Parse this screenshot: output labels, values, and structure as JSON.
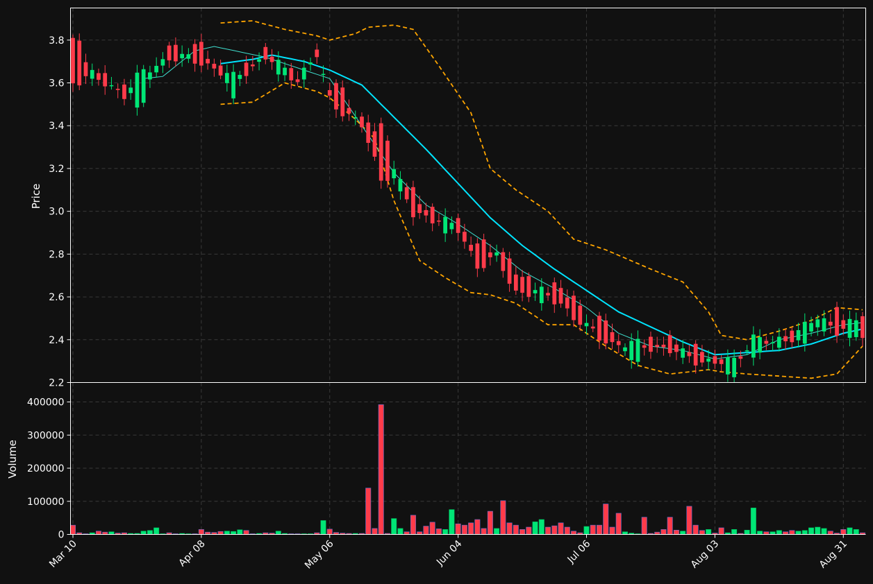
{
  "chart_data": [
    {
      "type": "candlestick",
      "panel": "price",
      "ylabel": "Price",
      "ylim": [
        2.2,
        3.95
      ],
      "yticks": [
        "2.2",
        "2.4",
        "2.6",
        "2.8",
        "3.0",
        "3.2",
        "3.4",
        "3.6",
        "3.8"
      ],
      "grid": true,
      "date_labels": [
        "Mar 10",
        "Apr 08",
        "May 06",
        "Jun 04",
        "Jul 06",
        "Aug 03",
        "Aug 31"
      ],
      "date_label_index": [
        0,
        20,
        40,
        60,
        80,
        100,
        120
      ],
      "bar_count": 124,
      "colors": {
        "up": "#00e676",
        "down": "#ff3b4a",
        "ma_fast": "#40e0d0",
        "ma_slow": "#00e5ff",
        "bands": "#ffa500",
        "background": "#111111",
        "grid": "#3a3a3a",
        "text": "#ffffff"
      },
      "overlays": [
        "ma_fast",
        "ma_slow",
        "bollinger_upper",
        "bollinger_lower"
      ],
      "anchors": {
        "open": [
          [
            0,
            3.79
          ],
          [
            3,
            3.67
          ],
          [
            8,
            3.55
          ],
          [
            11,
            3.53
          ],
          [
            15,
            3.75
          ],
          [
            20,
            3.76
          ],
          [
            25,
            3.58
          ],
          [
            30,
            3.75
          ],
          [
            35,
            3.59
          ],
          [
            38,
            3.74
          ],
          [
            40,
            3.6
          ],
          [
            45,
            3.43
          ],
          [
            48,
            3.4
          ],
          [
            50,
            3.15
          ],
          [
            53,
            3.1
          ],
          [
            57,
            2.93
          ],
          [
            60,
            2.95
          ],
          [
            63,
            2.82
          ],
          [
            66,
            2.84
          ],
          [
            69,
            2.72
          ],
          [
            72,
            2.62
          ],
          [
            76,
            2.64
          ],
          [
            80,
            2.51
          ],
          [
            84,
            2.45
          ],
          [
            86,
            2.32
          ],
          [
            90,
            2.37
          ],
          [
            93,
            2.4
          ],
          [
            97,
            2.33
          ],
          [
            100,
            2.32
          ],
          [
            103,
            2.25
          ],
          [
            106,
            2.34
          ],
          [
            109,
            2.4
          ],
          [
            112,
            2.39
          ],
          [
            116,
            2.45
          ],
          [
            119,
            2.5
          ],
          [
            122,
            2.43
          ],
          [
            123,
            2.49
          ]
        ],
        "close": [
          [
            0,
            3.61
          ],
          [
            3,
            3.63
          ],
          [
            8,
            3.55
          ],
          [
            11,
            3.65
          ],
          [
            15,
            3.72
          ],
          [
            20,
            3.7
          ],
          [
            25,
            3.62
          ],
          [
            30,
            3.72
          ],
          [
            35,
            3.62
          ],
          [
            38,
            3.73
          ],
          [
            40,
            3.52
          ],
          [
            45,
            3.4
          ],
          [
            48,
            3.15
          ],
          [
            50,
            3.2
          ],
          [
            53,
            2.98
          ],
          [
            57,
            2.97
          ],
          [
            60,
            2.91
          ],
          [
            63,
            2.75
          ],
          [
            66,
            2.78
          ],
          [
            69,
            2.62
          ],
          [
            72,
            2.63
          ],
          [
            76,
            2.57
          ],
          [
            80,
            2.45
          ],
          [
            84,
            2.38
          ],
          [
            86,
            2.38
          ],
          [
            90,
            2.37
          ],
          [
            93,
            2.35
          ],
          [
            97,
            2.31
          ],
          [
            100,
            2.29
          ],
          [
            103,
            2.3
          ],
          [
            106,
            2.41
          ],
          [
            109,
            2.38
          ],
          [
            112,
            2.42
          ],
          [
            116,
            2.5
          ],
          [
            119,
            2.45
          ],
          [
            122,
            2.48
          ],
          [
            123,
            2.42
          ]
        ]
      },
      "wick_pad": {
        "high": 0.04,
        "low": 0.04
      },
      "bands": {
        "upper": [
          [
            23,
            3.88
          ],
          [
            28,
            3.89
          ],
          [
            33,
            3.85
          ],
          [
            38,
            3.82
          ],
          [
            40,
            3.8
          ],
          [
            44,
            3.83
          ],
          [
            46,
            3.86
          ],
          [
            50,
            3.87
          ],
          [
            53,
            3.85
          ],
          [
            57,
            3.68
          ],
          [
            62,
            3.46
          ],
          [
            65,
            3.2
          ],
          [
            69,
            3.1
          ],
          [
            74,
            3.0
          ],
          [
            78,
            2.87
          ],
          [
            83,
            2.82
          ],
          [
            90,
            2.73
          ],
          [
            95,
            2.67
          ],
          [
            99,
            2.53
          ],
          [
            101,
            2.42
          ],
          [
            105,
            2.4
          ],
          [
            110,
            2.44
          ],
          [
            115,
            2.49
          ],
          [
            119,
            2.55
          ],
          [
            123,
            2.54
          ]
        ],
        "lower": [
          [
            23,
            3.5
          ],
          [
            28,
            3.51
          ],
          [
            33,
            3.6
          ],
          [
            38,
            3.56
          ],
          [
            40,
            3.53
          ],
          [
            44,
            3.43
          ],
          [
            47,
            3.34
          ],
          [
            50,
            3.05
          ],
          [
            54,
            2.77
          ],
          [
            58,
            2.69
          ],
          [
            62,
            2.62
          ],
          [
            65,
            2.61
          ],
          [
            69,
            2.57
          ],
          [
            74,
            2.47
          ],
          [
            78,
            2.47
          ],
          [
            83,
            2.37
          ],
          [
            88,
            2.28
          ],
          [
            93,
            2.24
          ],
          [
            99,
            2.26
          ],
          [
            101,
            2.25
          ],
          [
            105,
            2.24
          ],
          [
            110,
            2.23
          ],
          [
            115,
            2.22
          ],
          [
            119,
            2.24
          ],
          [
            123,
            2.37
          ]
        ]
      },
      "ma_fast": [
        [
          11,
          3.62
        ],
        [
          14,
          3.63
        ],
        [
          19,
          3.75
        ],
        [
          22,
          3.77
        ],
        [
          30,
          3.72
        ],
        [
          35,
          3.67
        ],
        [
          40,
          3.62
        ],
        [
          45,
          3.4
        ],
        [
          50,
          3.18
        ],
        [
          55,
          3.03
        ],
        [
          60,
          2.94
        ],
        [
          65,
          2.84
        ],
        [
          70,
          2.72
        ],
        [
          75,
          2.64
        ],
        [
          80,
          2.55
        ],
        [
          85,
          2.43
        ],
        [
          90,
          2.37
        ],
        [
          95,
          2.35
        ],
        [
          100,
          2.31
        ],
        [
          105,
          2.33
        ],
        [
          110,
          2.4
        ],
        [
          115,
          2.43
        ],
        [
          120,
          2.47
        ],
        [
          123,
          2.48
        ]
      ],
      "ma_slow": [
        [
          23,
          3.69
        ],
        [
          28,
          3.71
        ],
        [
          31,
          3.73
        ],
        [
          36,
          3.7
        ],
        [
          40,
          3.66
        ],
        [
          45,
          3.59
        ],
        [
          50,
          3.44
        ],
        [
          55,
          3.29
        ],
        [
          60,
          3.13
        ],
        [
          65,
          2.97
        ],
        [
          70,
          2.84
        ],
        [
          75,
          2.73
        ],
        [
          80,
          2.63
        ],
        [
          85,
          2.53
        ],
        [
          90,
          2.46
        ],
        [
          95,
          2.39
        ],
        [
          100,
          2.33
        ],
        [
          105,
          2.34
        ],
        [
          110,
          2.35
        ],
        [
          115,
          2.38
        ],
        [
          120,
          2.43
        ],
        [
          123,
          2.45
        ]
      ]
    },
    {
      "type": "bar",
      "panel": "volume",
      "ylabel": "Volume",
      "ylim": [
        0,
        420000
      ],
      "yticks": [
        "0",
        "100000",
        "200000",
        "300000",
        "400000"
      ],
      "grid": true,
      "values": [
        28000,
        5000,
        2000,
        5000,
        10000,
        7000,
        8000,
        4000,
        5000,
        3000,
        3000,
        10000,
        12000,
        20000,
        2000,
        5000,
        2000,
        3000,
        2000,
        2000,
        15000,
        7000,
        6000,
        9000,
        10000,
        9000,
        14000,
        12000,
        2000,
        3000,
        5000,
        4000,
        10000,
        3000,
        2000,
        2000,
        2000,
        2000,
        5000,
        42000,
        16000,
        6000,
        4000,
        3000,
        3000,
        3000,
        140000,
        18000,
        392000,
        3000,
        48000,
        18000,
        8000,
        58000,
        8000,
        25000,
        37000,
        17000,
        15000,
        75000,
        32000,
        28000,
        35000,
        45000,
        18000,
        70000,
        18000,
        102000,
        35000,
        28000,
        15000,
        22000,
        38000,
        45000,
        22000,
        26000,
        35000,
        22000,
        10000,
        5000,
        24000,
        28000,
        28000,
        92000,
        22000,
        64000,
        8000,
        4000,
        2000,
        52000,
        3000,
        7000,
        15000,
        52000,
        13000,
        10000,
        85000,
        28000,
        12000,
        15000,
        4000,
        20000,
        5000,
        15000,
        3000,
        13000,
        80000,
        10000,
        8000,
        8000,
        12000,
        8000,
        12000,
        10000,
        12000,
        20000,
        22000,
        18000,
        10000,
        4000,
        15000,
        20000,
        15000,
        5000
      ]
    }
  ]
}
